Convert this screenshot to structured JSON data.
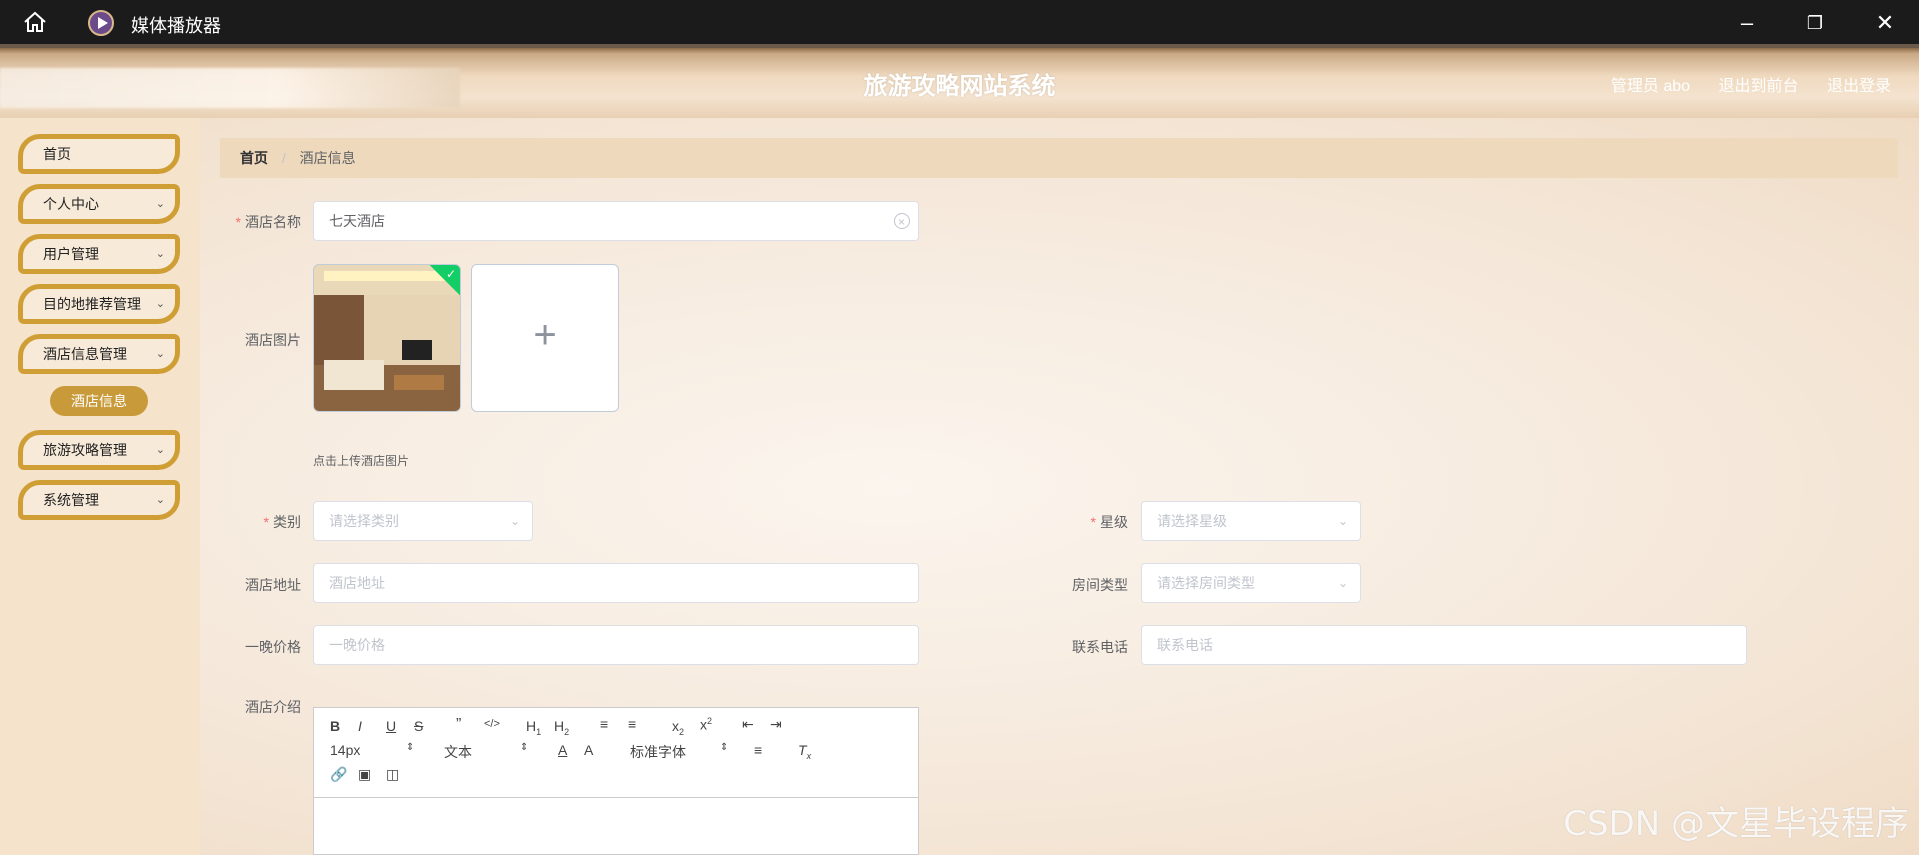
{
  "window": {
    "app_title": "媒体播放器"
  },
  "header": {
    "site_title": "旅游攻略网站系统",
    "admin_label": "管理员 abo",
    "exit_front": "退出到前台",
    "logout": "退出登录"
  },
  "sidebar": {
    "items": [
      {
        "label": "首页"
      },
      {
        "label": "个人中心"
      },
      {
        "label": "用户管理"
      },
      {
        "label": "目的地推荐管理"
      },
      {
        "label": "酒店信息管理"
      },
      {
        "label": "旅游攻略管理"
      },
      {
        "label": "系统管理"
      }
    ],
    "active_sub": "酒店信息"
  },
  "breadcrumb": {
    "home": "首页",
    "sep": "/",
    "current": "酒店信息"
  },
  "form": {
    "hotel_name": {
      "label": "酒店名称",
      "value": "七天酒店"
    },
    "hotel_image": {
      "label": "酒店图片",
      "tip": "点击上传酒店图片"
    },
    "category": {
      "label": "类别",
      "placeholder": "请选择类别"
    },
    "star": {
      "label": "星级",
      "placeholder": "请选择星级"
    },
    "address": {
      "label": "酒店地址",
      "placeholder": "酒店地址"
    },
    "room_type": {
      "label": "房间类型",
      "placeholder": "请选择房间类型"
    },
    "price": {
      "label": "一晚价格",
      "placeholder": "一晚价格"
    },
    "phone": {
      "label": "联系电话",
      "placeholder": "联系电话"
    },
    "intro": {
      "label": "酒店介绍"
    }
  },
  "editor": {
    "font_size": "14px",
    "text_style": "文本",
    "font_family": "标准字体"
  },
  "watermark": "CSDN @文星毕设程序"
}
